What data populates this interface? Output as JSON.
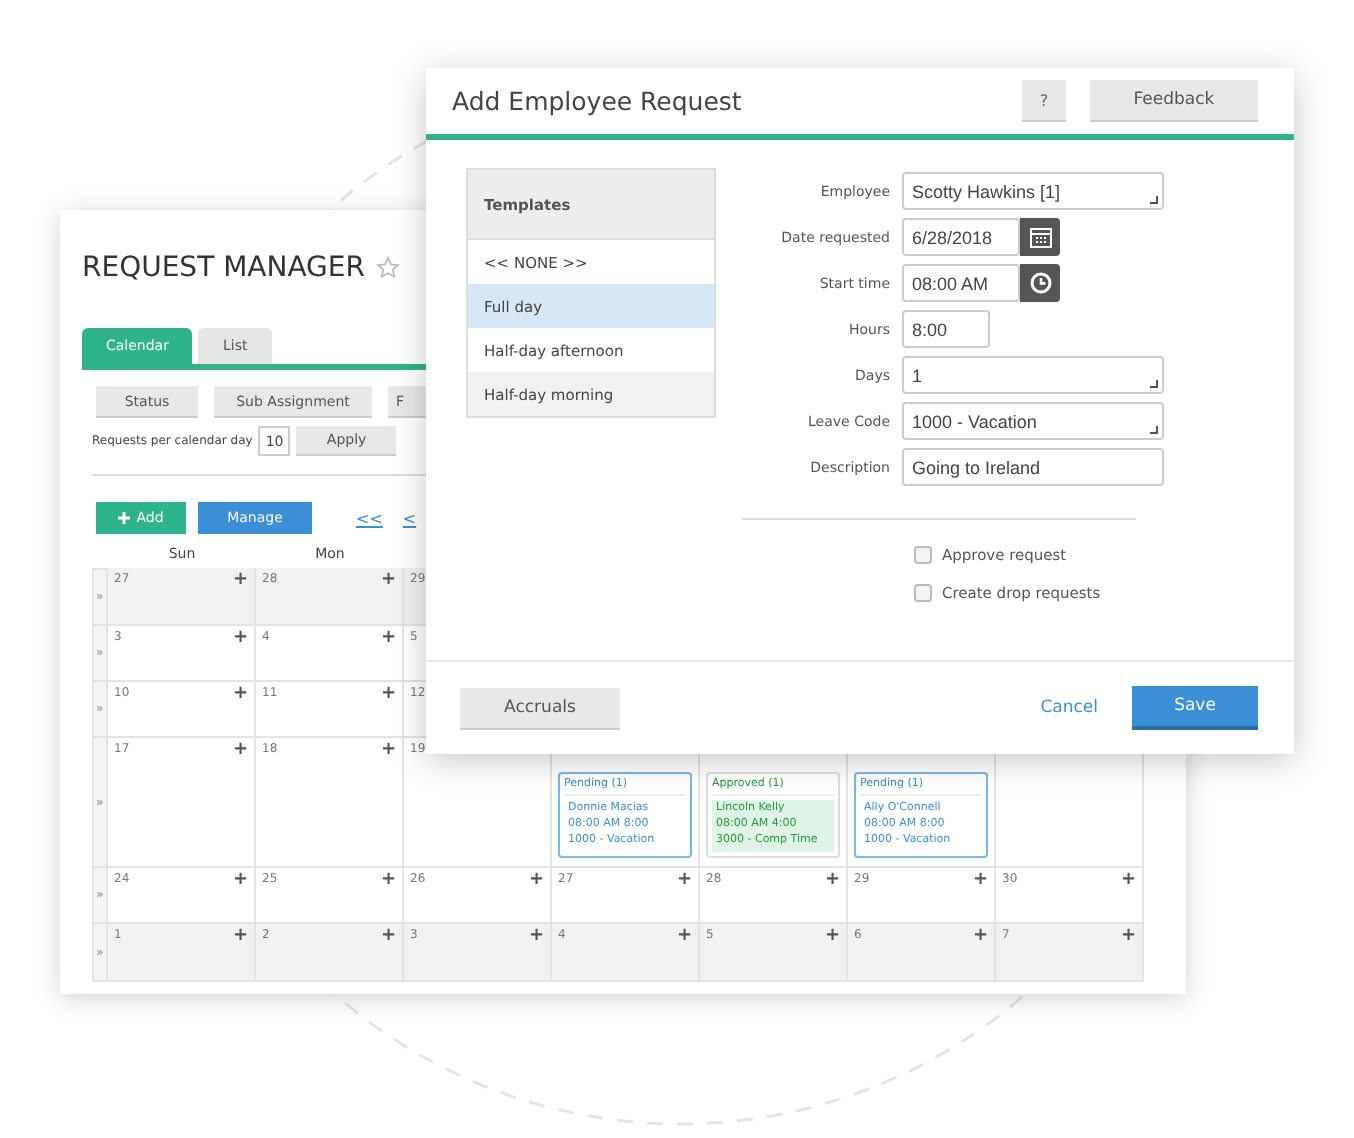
{
  "request_manager": {
    "title": "REQUEST MANAGER",
    "favorite": false,
    "tabs": [
      {
        "label": "Calendar",
        "selected": true
      },
      {
        "label": "List",
        "selected": false
      }
    ],
    "filters": [
      "Status",
      "Sub Assignment",
      "F"
    ],
    "per_day": {
      "label": "Requests per calendar day",
      "value": "10",
      "button": "Apply"
    },
    "add_button": "Add",
    "manage_button": "Manage",
    "nav_links": [
      "<<",
      "<"
    ],
    "calendar": {
      "headers": [
        "Sun",
        "Mon"
      ],
      "weeks": [
        {
          "expander": "»",
          "days": [
            {
              "day": "27",
              "add": "+"
            },
            {
              "day": "28",
              "add": "+"
            },
            {
              "day": "29"
            }
          ]
        },
        {
          "expander": "»",
          "days": [
            {
              "day": "3",
              "add": "+"
            },
            {
              "day": "4",
              "add": "+"
            },
            {
              "day": "5"
            }
          ]
        },
        {
          "expander": "»",
          "days": [
            {
              "day": "10",
              "add": "+"
            },
            {
              "day": "11",
              "add": "+"
            },
            {
              "day": "12"
            }
          ]
        },
        {
          "expander": "»",
          "days": [
            {
              "day": "17",
              "add": "+"
            },
            {
              "day": "18",
              "add": "+"
            },
            {
              "day": "19"
            },
            {
              "event": {
                "kind": "pending",
                "status": "Pending (1)",
                "lines": [
                  "Donnie Macias",
                  "08:00 AM 8:00",
                  "1000 - Vacation"
                ]
              }
            },
            {
              "event": {
                "kind": "approved",
                "status": "Approved (1)",
                "lines": [
                  "Lincoln Kelly",
                  "08:00 AM 4:00",
                  "3000 - Comp Time"
                ]
              }
            },
            {
              "event": {
                "kind": "pending",
                "status": "Pending (1)",
                "lines": [
                  "Ally O'Connell",
                  "08:00 AM 8:00",
                  "1000 - Vacation"
                ]
              }
            }
          ]
        },
        {
          "expander": "»",
          "days": [
            {
              "day": "24",
              "add": "+"
            },
            {
              "day": "25",
              "add": "+"
            },
            {
              "day": "26",
              "add": "+"
            },
            {
              "day": "27",
              "add": "+"
            },
            {
              "day": "28",
              "add": "+"
            },
            {
              "day": "29",
              "add": "+"
            },
            {
              "day": "30",
              "add": "+"
            }
          ]
        },
        {
          "expander": "»",
          "days": [
            {
              "day": "1",
              "add": "+"
            },
            {
              "day": "2",
              "add": "+"
            },
            {
              "day": "3",
              "add": "+"
            },
            {
              "day": "4",
              "add": "+"
            },
            {
              "day": "5",
              "add": "+"
            },
            {
              "day": "6",
              "add": "+"
            },
            {
              "day": "7",
              "add": "+"
            }
          ]
        }
      ]
    }
  },
  "dialog": {
    "title": "Add Employee Request",
    "help_button": "?",
    "feedback_button": "Feedback",
    "templates": {
      "header": "Templates",
      "items": [
        {
          "label": "<< NONE >>",
          "selected": false
        },
        {
          "label": "Full day",
          "selected": true
        },
        {
          "label": "Half-day afternoon",
          "selected": false
        },
        {
          "label": "Half-day morning",
          "selected": false
        }
      ]
    },
    "fields": [
      {
        "label": "Employee",
        "value": "Scotty Hawkins [1]",
        "kind": "select"
      },
      {
        "label": "Date requested",
        "value": "6/28/2018",
        "kind": "date"
      },
      {
        "label": "Start time",
        "value": "08:00 AM",
        "kind": "time"
      },
      {
        "label": "Hours",
        "value": "8:00",
        "kind": "short"
      },
      {
        "label": "Days",
        "value": "1",
        "kind": "select"
      },
      {
        "label": "Leave Code",
        "value": "1000 - Vacation",
        "kind": "select"
      },
      {
        "label": "Description",
        "value": "Going to Ireland",
        "kind": "text"
      }
    ],
    "checkboxes": [
      {
        "label": "Approve request",
        "checked": false
      },
      {
        "label": "Create drop requests",
        "checked": false
      }
    ],
    "accruals_button": "Accruals",
    "cancel_link": "Cancel",
    "save_button": "Save"
  }
}
